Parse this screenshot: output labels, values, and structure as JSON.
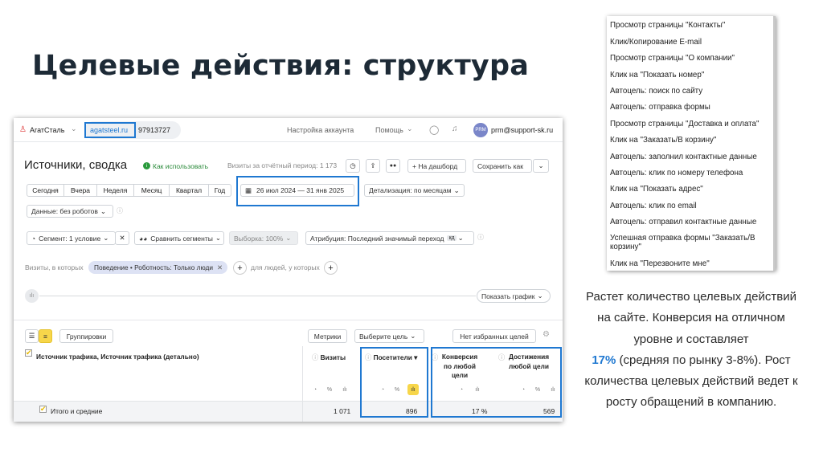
{
  "slide": {
    "title": "Целевые действия: структура",
    "paragraph_before": "Растет количество целевых действий на сайте. Конверсия на отличном уровне и составляет",
    "highlight": "17%",
    "paragraph_after": " (средняя по рынку 3-8%). Рост количества целевых действий ведет к росту обращений в компанию.",
    "accent_color": "#1f78d1"
  },
  "header": {
    "account": "АгатСталь",
    "site": "agatsteel.ru",
    "counter_id": "97913727",
    "account_settings": "Настройка аккаунта",
    "help": "Помощь",
    "user_badge": "PRM",
    "user_email": "prm@support-sk.ru"
  },
  "report": {
    "title": "Источники, сводка",
    "how_to_use": "Как использовать",
    "visits_info": "Визиты за отчётный период: 1 173",
    "to_dashboard": "На дашборд",
    "save_as": "Сохранить как",
    "periods": [
      "Сегодня",
      "Вчера",
      "Неделя",
      "Месяц",
      "Квартал",
      "Год"
    ],
    "date_range": "26 июл 2024 — 31 янв 2025",
    "detail": "Детализация: по месяцам",
    "data_filter": "Данные: без роботов",
    "segment": "Сегмент: 1 условие",
    "compare": "Сравнить сегменты",
    "sample": "Выборка: 100%",
    "attribution": "Атрибуция: Последний значимый переход",
    "attribution_badge": "кд",
    "visits_where": "Визиты, в которых",
    "behavior_tag": "Поведение • Роботность: Только люди",
    "people_where": "для людей, у которых",
    "show_chart": "Показать график"
  },
  "table": {
    "groupings": "Группировки",
    "metrics": "Метрики",
    "select_goal": "Выберите цель",
    "no_favorites": "Нет избранных целей",
    "dimension_header": "Источник трафика, Источник трафика (детально)",
    "columns": [
      {
        "label": "Визиты"
      },
      {
        "label": "Посетители"
      },
      {
        "label_lines": [
          "Конверсия",
          "по любой",
          "цели"
        ]
      },
      {
        "label_lines": [
          "Достижения",
          "любой цели"
        ]
      }
    ],
    "total_label": "Итого и средние",
    "totals": [
      "1 071",
      "896",
      "17 %",
      "569"
    ],
    "icons": {
      "pie": "%",
      "bar": "ılı"
    }
  },
  "goals_list": [
    "Просмотр страницы \"Контакты\"",
    "Клик/Копирование E-mail",
    "Просмотр страницы \"О компании\"",
    "Клик на \"Показать номер\"",
    "Автоцель: поиск по сайту",
    "Автоцель: отправка формы",
    "Просмотр страницы \"Доставка и оплата\"",
    "Клик на \"Заказать/В корзину\"",
    "Автоцель: заполнил контактные данные",
    "Автоцель: клик по номеру телефона",
    "Клик на \"Показать адрес\"",
    "Автоцель: клик по email",
    "Автоцель: отправил контактные данные",
    "Успешная отправка формы \"Заказать/В корзину\"",
    "Клик на \"Перезвоните мне\""
  ]
}
